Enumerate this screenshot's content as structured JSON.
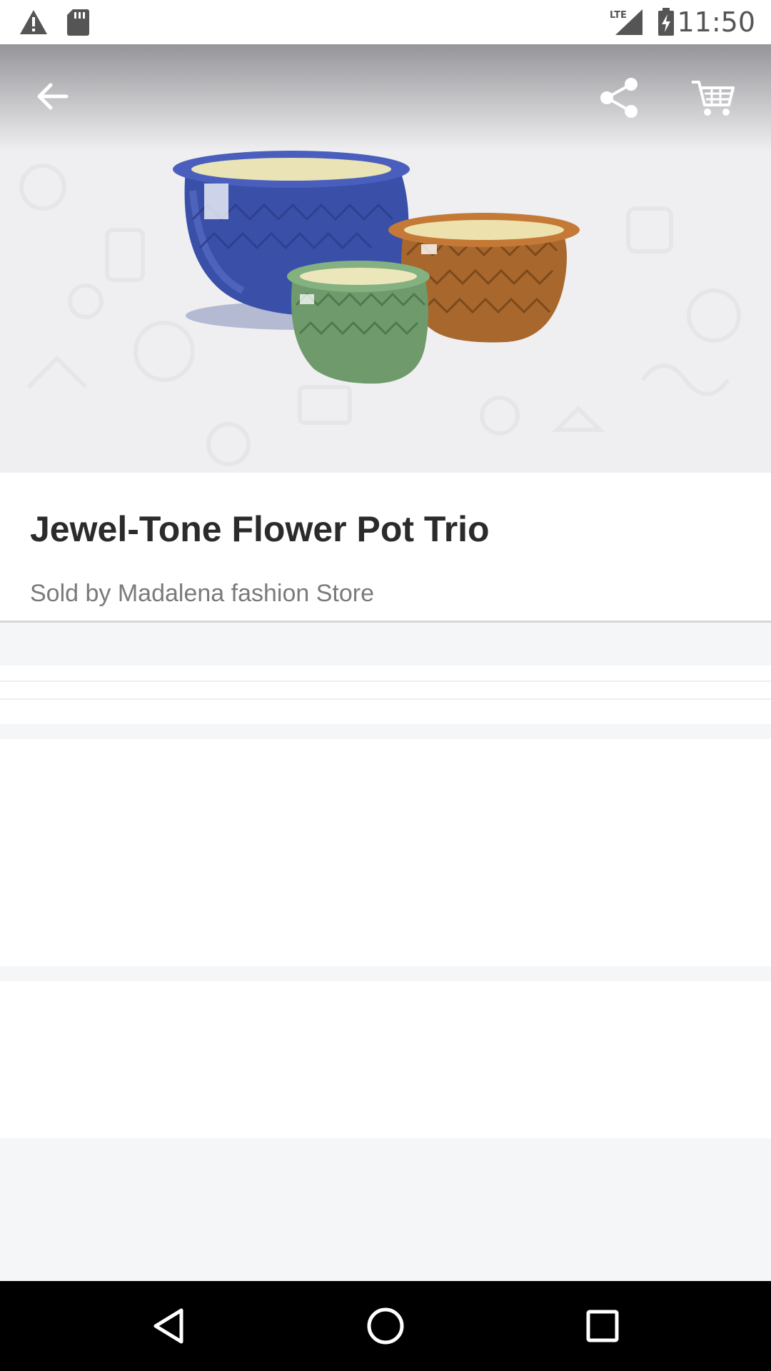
{
  "status_bar": {
    "time": "11:50",
    "icons": [
      "warning-icon",
      "sd-card-icon",
      "lte-signal-icon",
      "battery-charging-icon"
    ]
  },
  "toolbar": {
    "icons": [
      "back-arrow-icon",
      "share-icon",
      "cart-icon"
    ]
  },
  "product": {
    "title": "Jewel-Tone Flower Pot Trio",
    "seller": "Sold by Madalena fashion Store",
    "image": "three glazed ceramic flower pots (blue, green, amber)"
  },
  "colors": {
    "pot_blue": "#3a4fa8",
    "pot_green": "#6e9a6c",
    "pot_amber": "#a8672c",
    "nav_bar": "#000000"
  },
  "nav_bar": {
    "icons": [
      "back-triangle-icon",
      "home-circle-icon",
      "recents-square-icon"
    ]
  }
}
